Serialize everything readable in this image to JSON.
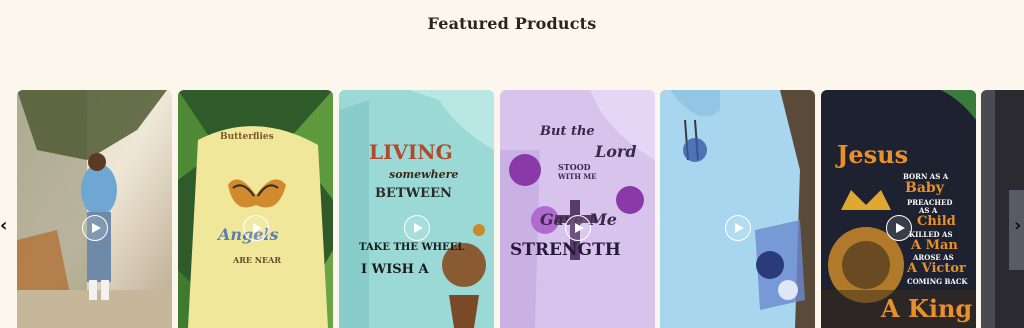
{
  "section": {
    "title": "Featured Products"
  },
  "nav": {
    "prev_icon": "chevron-left-icon",
    "next_icon": "chevron-right-icon",
    "prev_glyph": "‹",
    "next_glyph": "›"
  },
  "products": [
    {
      "name": "woman-back-blue-tee",
      "has_video": true
    },
    {
      "name": "butterfly-angels-tee",
      "has_video": true,
      "shirt_text": [
        "Butterflies",
        "Angels",
        "ARE NEAR"
      ]
    },
    {
      "name": "living-somewhere-between-hoodie",
      "has_video": true,
      "shirt_text": [
        "LIVING",
        "somewhere",
        "BETWEEN",
        "TAKE THE WHEEL",
        "I WISH A"
      ]
    },
    {
      "name": "but-the-lord-stood-hoodie",
      "has_video": true,
      "shirt_text": [
        "But the",
        "Lord",
        "STOOD",
        "WITH ME",
        "Gave Me",
        "STRENGTH"
      ]
    },
    {
      "name": "light-blue-floral-cross-hoodie",
      "has_video": true
    },
    {
      "name": "jesus-lion-hoodie",
      "has_video": true,
      "shirt_text": [
        "Jesus",
        "BORN AS A",
        "Baby",
        "PREACHED",
        "AS A",
        "Child",
        "KILLED AS",
        "A Man",
        "AROSE AS",
        "A Victor",
        "COMING BACK",
        "A King"
      ]
    },
    {
      "name": "dark-partial-card",
      "has_video": false
    }
  ],
  "colors": {
    "background": "#fdf6ec",
    "title": "#2b2420"
  }
}
